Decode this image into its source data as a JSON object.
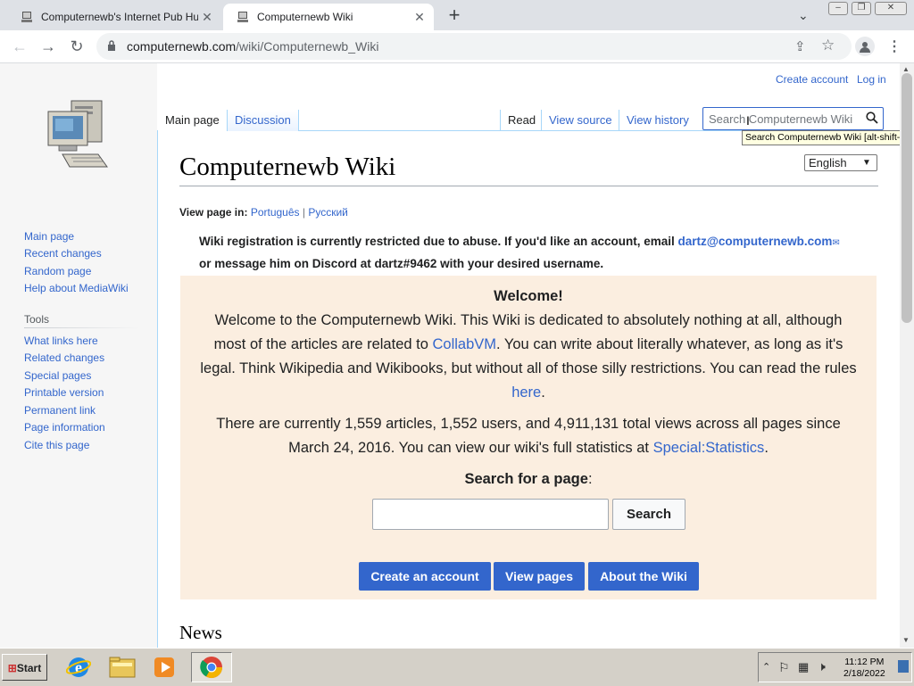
{
  "browser": {
    "tabs": [
      {
        "title": "Computernewb's Internet Pub Hub",
        "active": false
      },
      {
        "title": "Computernewb Wiki",
        "active": true
      }
    ],
    "url_host": "computernewb.com",
    "url_path": "/wiki/Computernewb_Wiki"
  },
  "wiki": {
    "top_links": {
      "create_account": "Create account",
      "log_in": "Log in"
    },
    "left_tabs": {
      "main_page": "Main page",
      "discussion": "Discussion"
    },
    "right_tabs": {
      "read": "Read",
      "view_source": "View source",
      "view_history": "View history"
    },
    "search": {
      "placeholder": "Search Computernewb Wiki",
      "tooltip": "Search Computernewb Wiki [alt-shift-f]"
    },
    "sidebar": {
      "nav": [
        "Main page",
        "Recent changes",
        "Random page",
        "Help about MediaWiki"
      ],
      "tools_heading": "Tools",
      "tools": [
        "What links here",
        "Related changes",
        "Special pages",
        "Printable version",
        "Permanent link",
        "Page information",
        "Cite this page"
      ]
    },
    "page_title": "Computernewb Wiki",
    "language_select": "English",
    "view_page_in": {
      "label": "View page in:",
      "languages": [
        "Português",
        "Русский"
      ],
      "separator": "|"
    },
    "notice": {
      "text1": "Wiki registration is currently restricted due to abuse. If you'd like an account, email ",
      "email": "dartz@computernewb.com",
      "text2": "or message him on Discord at dartz#9462 with your desired username."
    },
    "welcome": {
      "heading": "Welcome!",
      "p1_a": "Welcome to the Computernewb Wiki. This Wiki is dedicated to absolutely nothing at all, although",
      "p1_b": "most of the articles are related to ",
      "p1_link": "CollabVM",
      "p1_c": ". You can write about literally whatever, as long as it's",
      "p1_d": "legal. Think Wikipedia and Wikibooks, but without all of those silly restrictions. You can read the rules",
      "p1_link2": "here",
      "p1_e": ".",
      "p2_a": "There are currently 1,559 articles, 1,552 users, and 4,911,131 total views across all pages since",
      "p2_b": "March 24, 2016. You can view our wiki's full statistics at ",
      "p2_link": "Special:Statistics",
      "p2_c": ".",
      "search_label": "Search for a page",
      "search_colon": ":",
      "search_button": "Search",
      "buttons": [
        "Create an account",
        "View pages",
        "About the Wiki"
      ]
    },
    "news_heading": "News"
  },
  "taskbar": {
    "start": "Start",
    "time": "11:12 PM",
    "date": "2/18/2022"
  }
}
